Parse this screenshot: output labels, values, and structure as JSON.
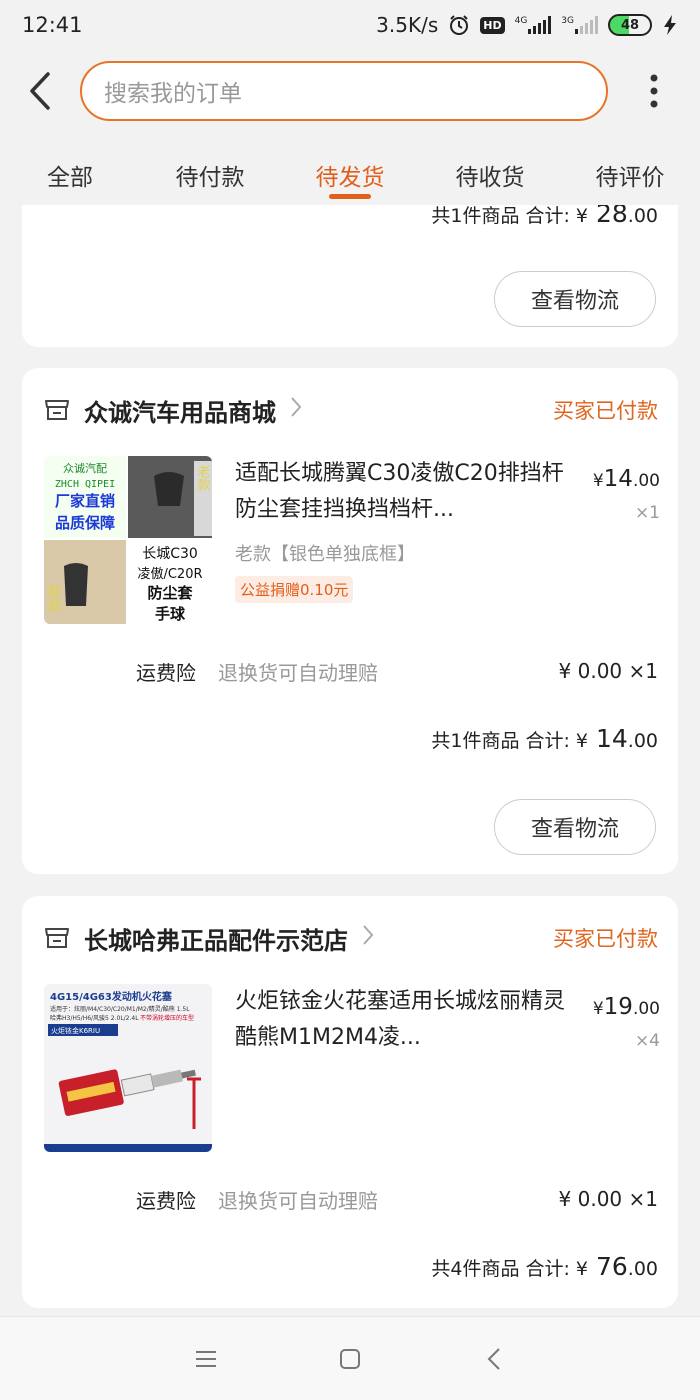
{
  "status_bar": {
    "time": "12:41",
    "net_speed": "3.5K/s",
    "hd": "HD",
    "net1": "4G",
    "net2": "3G",
    "battery": "48"
  },
  "search": {
    "placeholder": "搜索我的订单"
  },
  "tabs": [
    {
      "label": "全部",
      "active": false
    },
    {
      "label": "待付款",
      "active": false
    },
    {
      "label": "待发货",
      "active": true
    },
    {
      "label": "待收货",
      "active": false
    },
    {
      "label": "待评价",
      "active": false
    }
  ],
  "orders": [
    {
      "summary": {
        "count_text": "共1件商品",
        "total_label": "合计:",
        "currency": "¥",
        "amount_int": "28",
        "amount_dec": ".00"
      },
      "logistics_label": "查看物流"
    },
    {
      "shop": "众诚汽车用品商城",
      "status": "买家已付款",
      "item": {
        "title": "适配长城腾翼C30凌傲C20排挡杆防尘套挂挡换挡档杆...",
        "currency": "¥",
        "price_int": "14",
        "price_dec": ".00",
        "qty": "×1",
        "sku": "老款【银色单独底框】",
        "charity": "公益捐赠0.10元",
        "thumb_texts": [
          "众诚汽配",
          "ZHCH QIPEI",
          "厂家直销",
          "品质保障",
          "老款",
          "长城C30",
          "凌傲/C20R",
          "防尘套",
          "手球",
          "新款"
        ]
      },
      "insurance": {
        "label": "运费险",
        "desc": "退换货可自动理赔",
        "price": "¥ 0.00 ×1"
      },
      "summary": {
        "count_text": "共1件商品",
        "total_label": "合计:",
        "currency": "¥",
        "amount_int": "14",
        "amount_dec": ".00"
      },
      "logistics_label": "查看物流"
    },
    {
      "shop": "长城哈弗正品配件示范店",
      "status": "买家已付款",
      "item": {
        "title": "火炬铱金火花塞适用长城炫丽精灵酷熊M1M2M4凌...",
        "currency": "¥",
        "price_int": "19",
        "price_dec": ".00",
        "qty": "×4",
        "thumb_texts": [
          "4G15/4G63发动机火花塞",
          "适用于：炫丽/M4/C30/C20/M1/M2/精灵/酷熊 1.5L",
          "哈弗H3/H5/H6/风骏5 2.0L/2.4L",
          "不带涡轮增压的车型",
          "火炬铱金K6RIU"
        ]
      },
      "insurance": {
        "label": "运费险",
        "desc": "退换货可自动理赔",
        "price": "¥ 0.00 ×1"
      },
      "summary": {
        "count_text": "共4件商品",
        "total_label": "合计:",
        "currency": "¥",
        "amount_int": "76",
        "amount_dec": ".00"
      }
    }
  ]
}
